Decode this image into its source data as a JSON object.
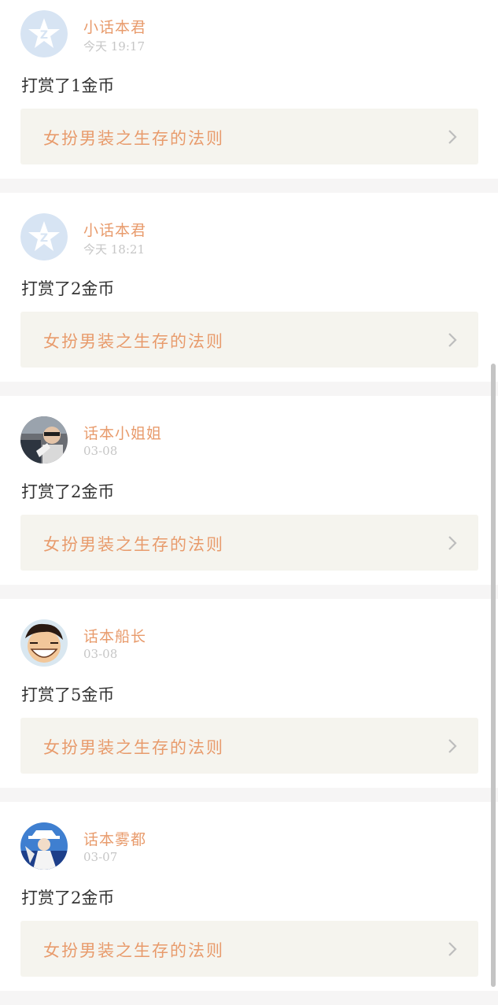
{
  "colors": {
    "accent": "#e89b6c",
    "text": "#333333",
    "muted": "#c6c6c6",
    "book_bg": "#f5f4ee",
    "page_bg": "#f6f5f5"
  },
  "items": [
    {
      "avatar": "qq-default-avatar",
      "username": "小话本君",
      "time": "今天 19:17",
      "reward": "打赏了1金币",
      "book": "女扮男装之生存的法则"
    },
    {
      "avatar": "qq-default-avatar",
      "username": "小话本君",
      "time": "今天 18:21",
      "reward": "打赏了2金币",
      "book": "女扮男装之生存的法则"
    },
    {
      "avatar": "photo-avatar",
      "username": "话本小姐姐",
      "time": "03-08",
      "reward": "打赏了2金币",
      "book": "女扮男装之生存的法则"
    },
    {
      "avatar": "luffy-avatar",
      "username": "话本船长",
      "time": "03-08",
      "reward": "打赏了5金币",
      "book": "女扮男装之生存的法则"
    },
    {
      "avatar": "kid-avatar",
      "username": "话本雾都",
      "time": "03-07",
      "reward": "打赏了2金币",
      "book": "女扮男装之生存的法则"
    }
  ]
}
